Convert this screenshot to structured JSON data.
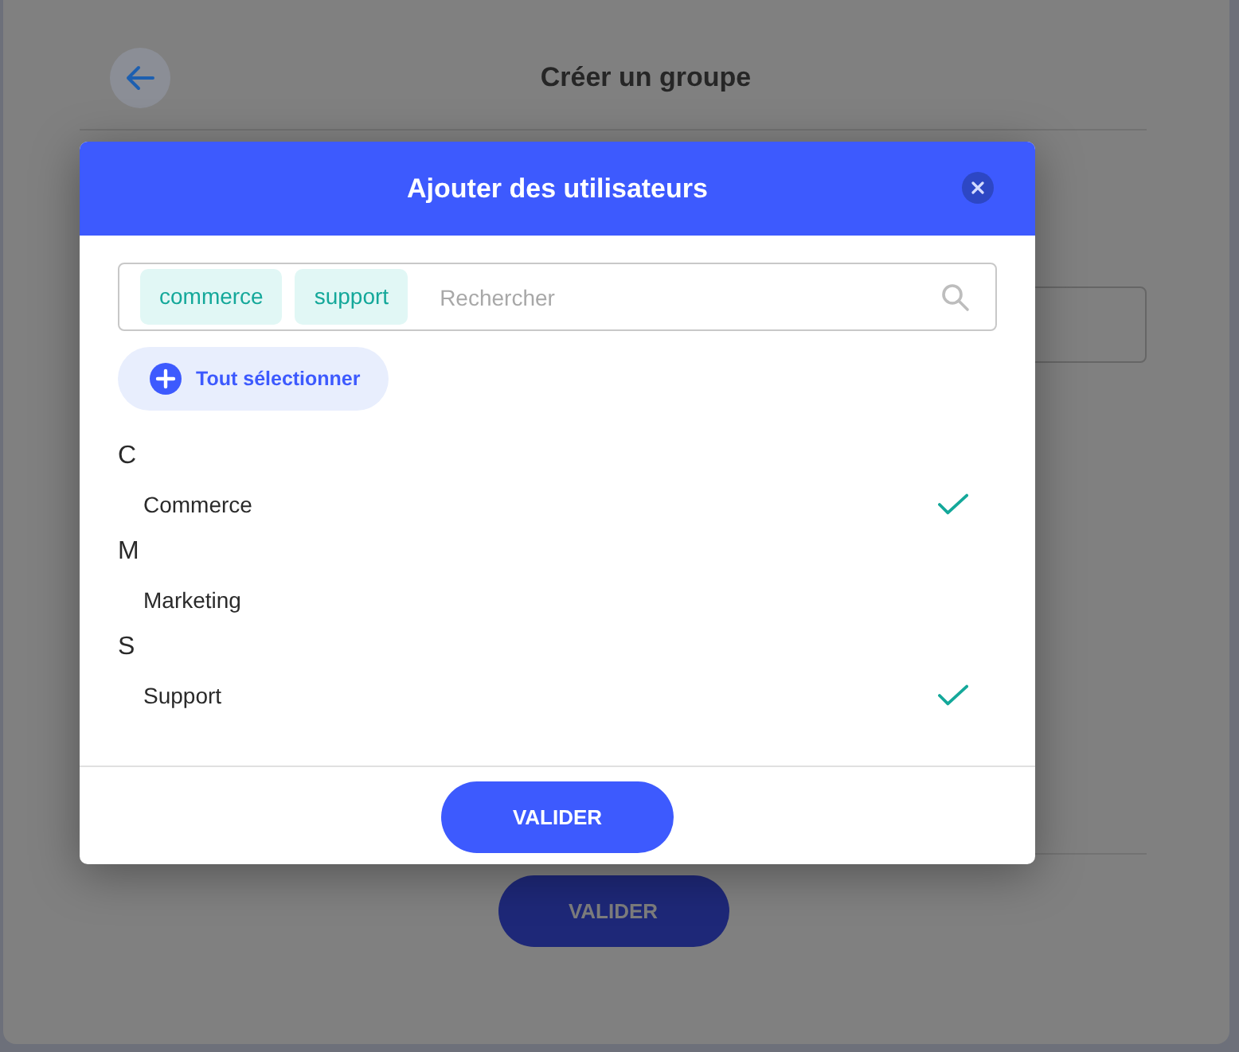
{
  "background_page": {
    "title": "Créer un groupe",
    "button": "VALIDER"
  },
  "dialog": {
    "title": "Ajouter des utilisateurs",
    "search": {
      "tags": [
        "commerce",
        "support"
      ],
      "placeholder": "Rechercher"
    },
    "select_all": "Tout sélectionner",
    "groups": [
      {
        "letter": "C",
        "items": [
          {
            "name": "Commerce",
            "selected": true
          }
        ]
      },
      {
        "letter": "M",
        "items": [
          {
            "name": "Marketing",
            "selected": false
          }
        ]
      },
      {
        "letter": "S",
        "items": [
          {
            "name": "Support",
            "selected": true
          }
        ]
      }
    ],
    "confirm_button": "VALIDER"
  }
}
